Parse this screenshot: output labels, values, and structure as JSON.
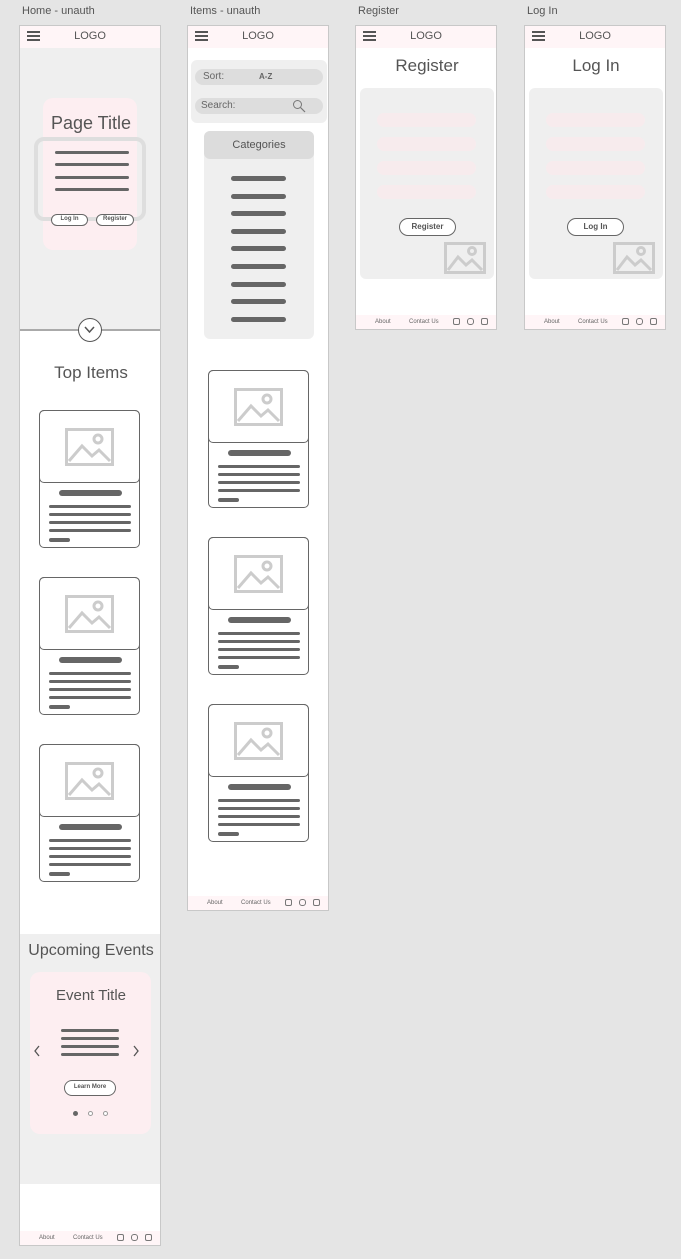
{
  "frames": {
    "home": {
      "title": "Home - unauth"
    },
    "items": {
      "title": "Items - unauth"
    },
    "register": {
      "title": "Register"
    },
    "login": {
      "title": "Log In"
    }
  },
  "header": {
    "logo": "LOGO"
  },
  "home": {
    "page_title": "Page Title",
    "login_label": "Log In",
    "register_label": "Register",
    "top_items_heading": "Top Items",
    "upcoming_heading": "Upcoming Events",
    "event_title": "Event Title",
    "learn_more_label": "Learn More",
    "carousel_dots": 3,
    "carousel_active": 0
  },
  "items_page": {
    "sort_label": "Sort:",
    "sort_value": "A-Z",
    "search_placeholder": "Search:",
    "categories_heading": "Categories",
    "category_count": 9
  },
  "register_page": {
    "heading": "Register",
    "submit_label": "Register"
  },
  "login_page": {
    "heading": "Log In",
    "submit_label": "Log In"
  },
  "footer": {
    "about": "About",
    "contact": "Contact Us"
  },
  "icons": [
    "menu-icon",
    "chevron-down-icon",
    "image-placeholder-icon",
    "search-icon",
    "chevron-left-icon",
    "chevron-right-icon",
    "twitter-icon",
    "instagram-icon",
    "facebook-icon"
  ],
  "colors": {
    "header_bg": "#fff5f7",
    "wireframe_stroke": "#666666",
    "panel_gray": "#efefef",
    "field_pink": "#fbe9ed"
  }
}
